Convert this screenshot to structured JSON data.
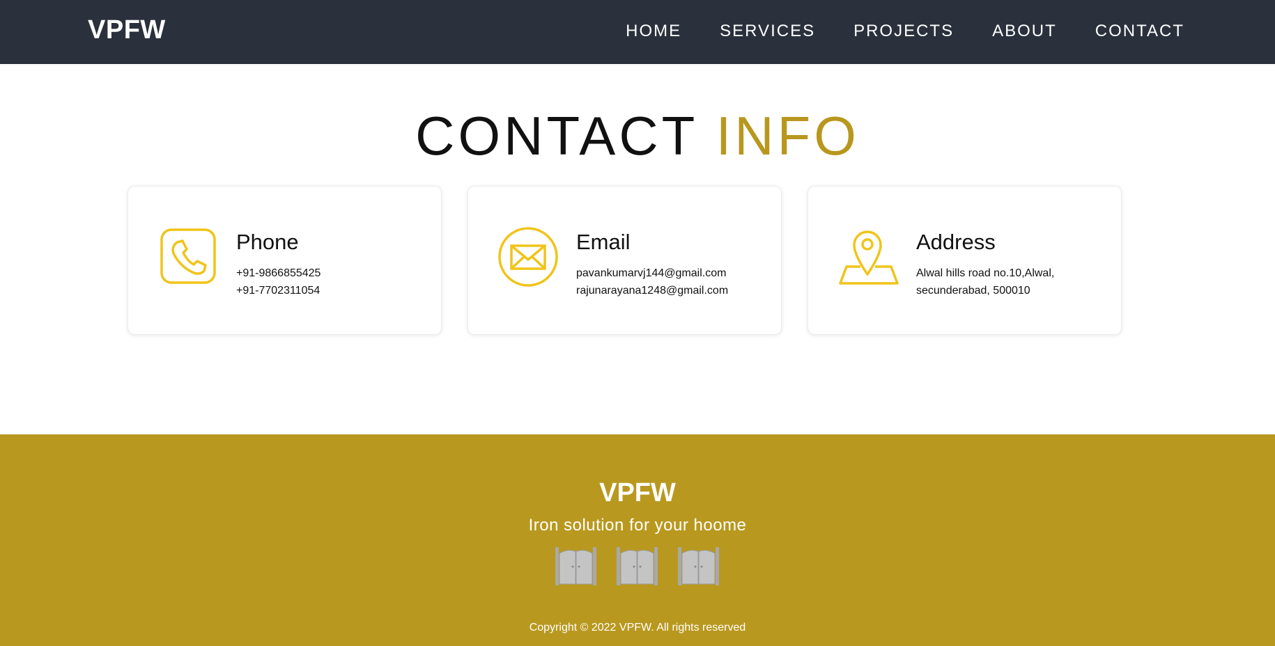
{
  "colors": {
    "nav_bg": "#2a313c",
    "accent_gold": "#b8971f",
    "icon_yellow": "#f0c419",
    "footer_bg": "#b9981f"
  },
  "navbar": {
    "brand": "VPFW",
    "links": [
      "HOME",
      "SERVICES",
      "PROJECTS",
      "ABOUT",
      "CONTACT"
    ]
  },
  "heading": {
    "part1": "CONTACT",
    "part2": "INFO"
  },
  "cards": [
    {
      "icon": "phone-icon",
      "title": "Phone",
      "lines": [
        "+91-9866855425",
        "+91-7702311054"
      ]
    },
    {
      "icon": "mail-icon",
      "title": "Email",
      "lines": [
        "pavankumarvj144@gmail.com",
        "rajunarayana1248@gmail.com"
      ]
    },
    {
      "icon": "map-pin-icon",
      "title": "Address",
      "lines": [
        "Alwal hills road no.10,Alwal,",
        "secunderabad, 500010"
      ]
    }
  ],
  "footer": {
    "brand": "VPFW",
    "tagline": "Iron solution for your hoome",
    "icons": [
      "gate-icon",
      "gate-icon",
      "gate-icon"
    ],
    "copyright": "Copyright © 2022 VPFW. All rights reserved"
  }
}
